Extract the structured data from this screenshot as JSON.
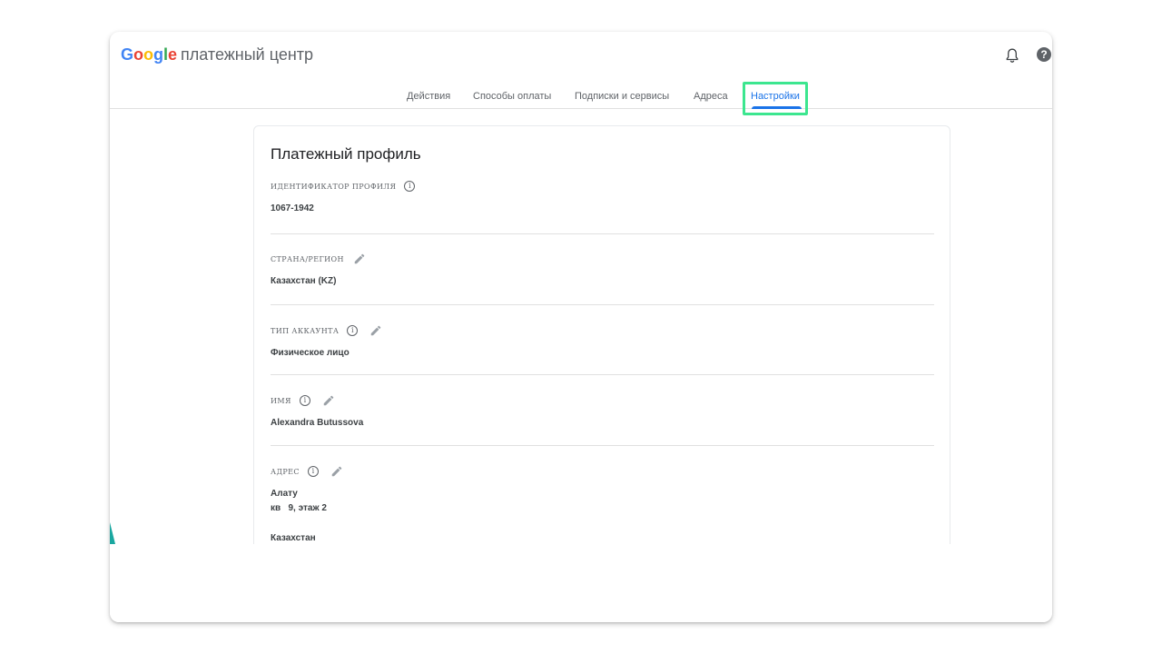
{
  "app": {
    "logo_text": "Google",
    "product_name": "платежный центр"
  },
  "header": {
    "notifications_icon": "bell-icon",
    "help_icon": "help-icon",
    "help_glyph": "?"
  },
  "tabs": [
    {
      "label": "Действия"
    },
    {
      "label": "Способы оплаты"
    },
    {
      "label": "Подписки и сервисы"
    },
    {
      "label": "Адреса"
    },
    {
      "label": "Настройки",
      "active": true
    }
  ],
  "colors": {
    "accent": "#1a73e8",
    "highlight": "#3ce68f"
  },
  "profile": {
    "title": "Платежный профиль",
    "fields": [
      {
        "label": "ИДЕНТИФИКАТОР ПРОФИЛЯ",
        "value": "1067-1942"
      },
      {
        "label": "СТРАНА/РЕГИОН",
        "value": "Казахстан (KZ)"
      },
      {
        "label": "ТИП АККАУНТА",
        "value": "Физическое лицо"
      },
      {
        "label": "ИМЯ",
        "value": "Alexandra Butussova"
      },
      {
        "label": "АДРЕС",
        "lines": [
          "Алату",
          "кв   9, этаж 2",
          "Казахстан"
        ]
      }
    ],
    "info_glyph": "i"
  }
}
